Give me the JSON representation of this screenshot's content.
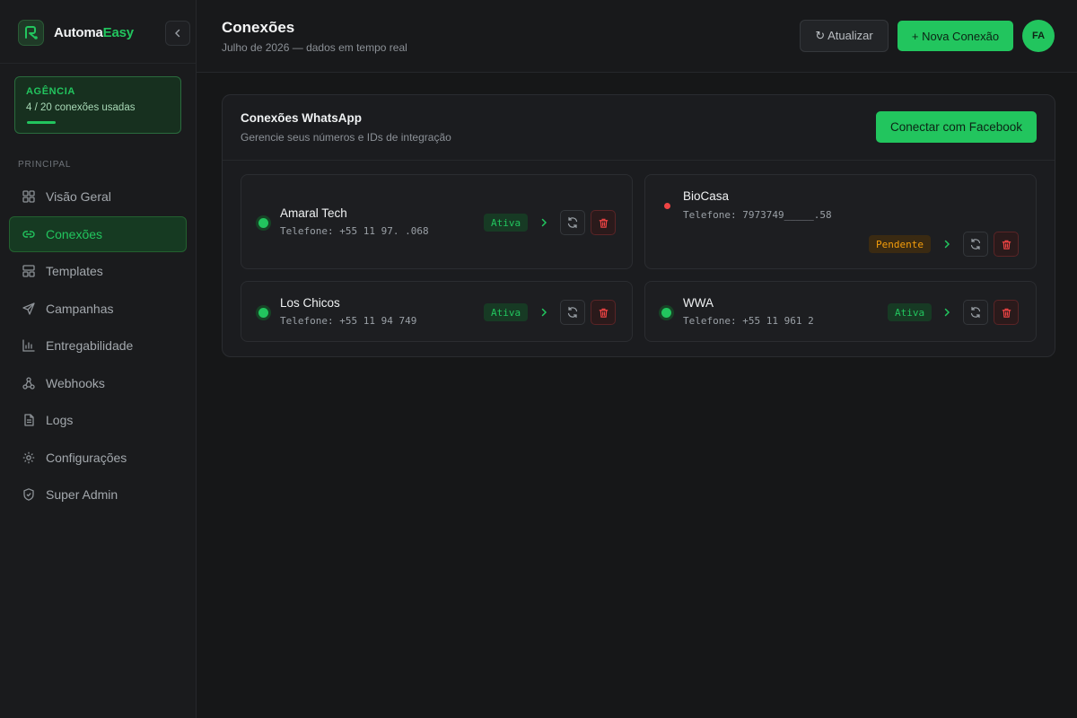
{
  "brand": {
    "name_prefix": "Automa",
    "name_accent": "Easy"
  },
  "plan": {
    "title": "AGÊNCIA",
    "usage_text": "4 / 20 conexões usadas",
    "used": 4,
    "total": 20
  },
  "sidebar": {
    "section_label": "PRINCIPAL",
    "items": [
      {
        "label": "Visão Geral",
        "icon": "grid-icon"
      },
      {
        "label": "Conexões",
        "icon": "link-icon",
        "active": true
      },
      {
        "label": "Templates",
        "icon": "layout-icon"
      },
      {
        "label": "Campanhas",
        "icon": "send-icon"
      },
      {
        "label": "Entregabilidade",
        "icon": "bar-chart-icon"
      },
      {
        "label": "Webhooks",
        "icon": "webhook-icon"
      },
      {
        "label": "Logs",
        "icon": "file-icon"
      },
      {
        "label": "Configurações",
        "icon": "gear-icon"
      },
      {
        "label": "Super Admin",
        "icon": "shield-icon"
      }
    ]
  },
  "header": {
    "title": "Conexões",
    "subtitle": "Julho de 2026 — dados em tempo real",
    "refresh_label": "↻ Atualizar",
    "new_label": "+ Nova Conexão",
    "avatar_initials": "FA"
  },
  "panel": {
    "title": "Conexões WhatsApp",
    "subtitle": "Gerencie seus números e IDs de integração",
    "facebook_button": "Conectar com Facebook"
  },
  "connections": [
    {
      "name": "Amaral Tech",
      "phone": "Telefone: +55 11 97.   .068",
      "status": "Ativa",
      "status_kind": "active"
    },
    {
      "name": "BioCasa",
      "phone": "Telefone: 7973749_____.58",
      "status": "Pendente",
      "status_kind": "pending"
    },
    {
      "name": "Los Chicos",
      "phone": "Telefone: +55 11 94      749",
      "status": "Ativa",
      "status_kind": "active"
    },
    {
      "name": "WWA",
      "phone": "Telefone: +55 11 961      2",
      "status": "Ativa",
      "status_kind": "active"
    }
  ],
  "colors": {
    "accent": "#22c55e",
    "danger": "#ef4444",
    "warning": "#f59e0b",
    "background": "#161718"
  }
}
